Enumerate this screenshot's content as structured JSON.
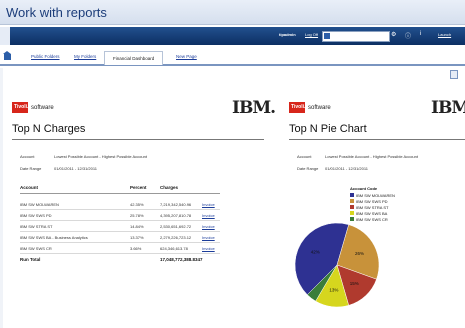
{
  "app": {
    "title": "Work with reports"
  },
  "header": {
    "user": "tipadmin",
    "logoff": "Log Off",
    "launch": "Launch"
  },
  "tabs": [
    {
      "label": "Public Folders"
    },
    {
      "label": "My Folders"
    },
    {
      "label": "Financial Dashboard"
    },
    {
      "label": "New Page"
    }
  ],
  "report1": {
    "brand": "Tivoli.",
    "software": "software",
    "ibm": "IBM.",
    "title": "Top N Charges",
    "account_label": "Account",
    "account_value": "Lowest Possible Account - Highest Possible Account",
    "date_label": "Date Range",
    "date_value": "01/01/2011 - 12/31/2011",
    "columns": [
      "Account",
      "Percent",
      "Charges"
    ],
    "rows": [
      {
        "account": "IBM  SW  MOLWAREN",
        "percent": "42.35%",
        "charges": "7,219,342,540.96",
        "link": "Invoice"
      },
      {
        "account": "IBM  SW  SWS  PD",
        "percent": "25.78%",
        "charges": "4,395,207,810.78",
        "link": "Invoice"
      },
      {
        "account": "IBM  SW  STRA  ST",
        "percent": "14.84%",
        "charges": "2,530,651,692.72",
        "link": "Invoice"
      },
      {
        "account": "IBM  SW  SWS  BA - Business Analytics",
        "percent": "13.37%",
        "charges": "2,279,226,723.12",
        "link": "Invoice"
      },
      {
        "account": "IBM  SW  SWS  CR",
        "percent": "3.66%",
        "charges": "624,346,613.78",
        "link": "Invoice"
      }
    ],
    "total_label": "Run Total",
    "total_value": "17,048,772,388.8347"
  },
  "report2": {
    "brand": "Tivoli.",
    "software": "software",
    "ibm": "IBM.",
    "title": "Top N Pie Chart",
    "account_label": "Account",
    "account_value": "Lowest Possible Account - Highest Possible Account",
    "date_label": "Date Range",
    "date_value": "01/01/2011 - 12/31/2011",
    "legend_title": "Account Code",
    "legend": [
      {
        "label": "IBM  SW  MOLWAREN",
        "color": "#2e3192"
      },
      {
        "label": "IBM  SW  SWS  PD",
        "color": "#c8923a"
      },
      {
        "label": "IBM  SW  STRA  ST",
        "color": "#b03a2e"
      },
      {
        "label": "IBM  SW  SWS  BA",
        "color": "#d6d61e"
      },
      {
        "label": "IBM  SW  SWS  CR",
        "color": "#3a7d3a"
      }
    ]
  },
  "chart_data": {
    "type": "pie",
    "categories": [
      "IBM SW MOLWAREN",
      "IBM SW SWS PD",
      "IBM SW STRA ST",
      "IBM SW SWS BA",
      "IBM SW SWS CR"
    ],
    "values": [
      42,
      26,
      15,
      13,
      4
    ],
    "labels": [
      "42%",
      "26%",
      "15%",
      "13%",
      "4%"
    ],
    "colors": [
      "#2e3192",
      "#c8923a",
      "#b03a2e",
      "#d6d61e",
      "#3a7d3a"
    ],
    "title": "",
    "legend": "right"
  }
}
